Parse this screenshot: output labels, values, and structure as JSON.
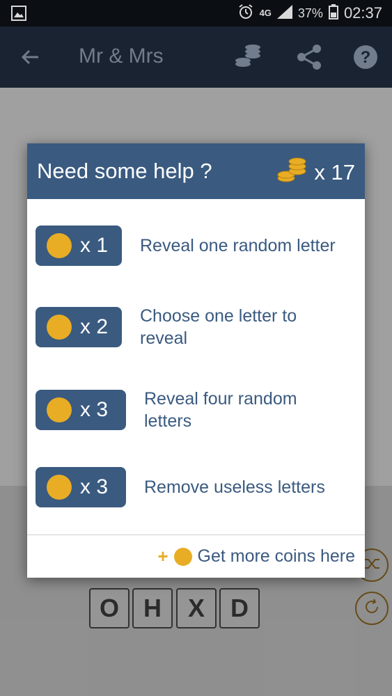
{
  "status_bar": {
    "network": "4G",
    "battery": "37%",
    "time": "02:37"
  },
  "app_bar": {
    "title": "Mr & Mrs"
  },
  "board": {
    "tiles_bottom_row": [
      "O",
      "H",
      "X",
      "D"
    ]
  },
  "dialog": {
    "title": "Need some help ?",
    "coins_count": "x 17",
    "options": [
      {
        "cost": "x 1",
        "label": "Reveal one random letter"
      },
      {
        "cost": "x 2",
        "label": "Choose one letter to reveal"
      },
      {
        "cost": "x 3",
        "label": "Reveal four random letters"
      },
      {
        "cost": "x 3",
        "label": "Remove useless letters"
      }
    ],
    "footer": {
      "plus": "+",
      "label": "Get more coins here"
    }
  },
  "colors": {
    "primary": "#3a5a80",
    "coin": "#e8ad24",
    "app_bar": "#1f2a3a"
  }
}
